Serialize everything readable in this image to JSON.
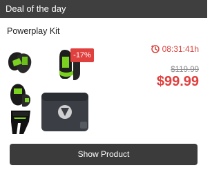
{
  "header": {
    "title": "Deal of the day"
  },
  "product": {
    "name": "Powerplay Kit",
    "discount_badge": "-17%",
    "timer": "08:31:41h",
    "old_price": "$119.99",
    "new_price": "$99.99",
    "image_icon": "hockey-gear-icon"
  },
  "colors": {
    "header_bg": "#3f3f3f",
    "accent": "#e0403e",
    "button_bg": "#3b3b3b"
  },
  "actions": {
    "show_product_label": "Show Product"
  }
}
